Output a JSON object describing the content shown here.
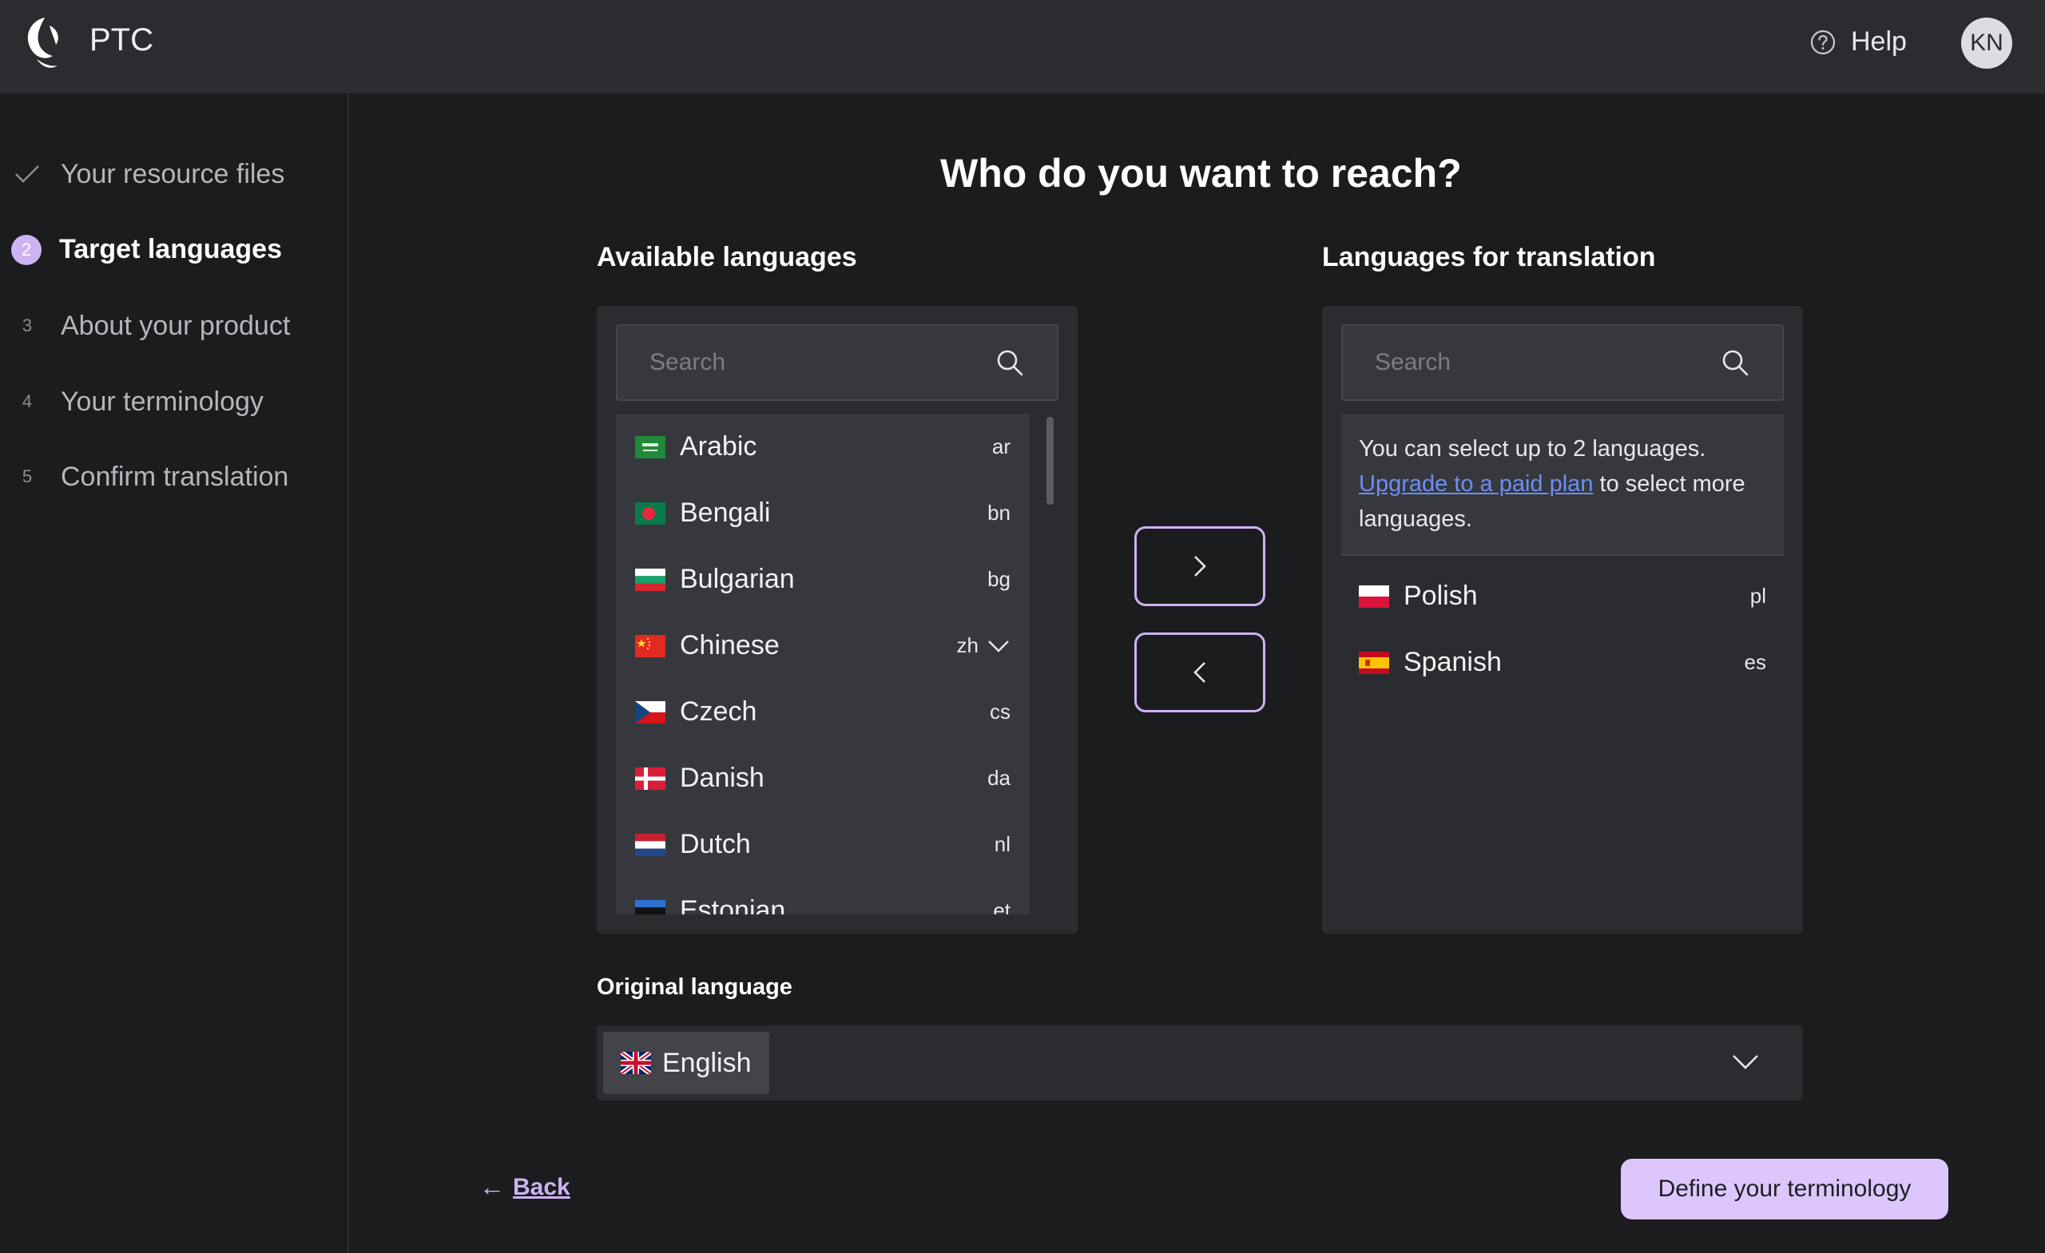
{
  "header": {
    "brand": "PTC",
    "help_label": "Help",
    "avatar_initials": "KN"
  },
  "sidebar": {
    "steps": [
      {
        "marker": "✓",
        "label": "Your resource files",
        "state": "done"
      },
      {
        "marker": "2",
        "label": "Target languages",
        "state": "active"
      },
      {
        "marker": "3",
        "label": "About your product",
        "state": "pending"
      },
      {
        "marker": "4",
        "label": "Your terminology",
        "state": "pending"
      },
      {
        "marker": "5",
        "label": "Confirm translation",
        "state": "pending"
      }
    ]
  },
  "main": {
    "title": "Who do you want to reach?",
    "available": {
      "title": "Available languages",
      "search_placeholder": "Search",
      "items": [
        {
          "name": "Arabic",
          "code": "ar",
          "flag": "sa-flag"
        },
        {
          "name": "Bengali",
          "code": "bn",
          "flag": "bd-flag"
        },
        {
          "name": "Bulgarian",
          "code": "bg",
          "flag": "bg-flag"
        },
        {
          "name": "Chinese",
          "code": "zh",
          "flag": "cn-flag",
          "expandable": true
        },
        {
          "name": "Czech",
          "code": "cs",
          "flag": "cz-flag"
        },
        {
          "name": "Danish",
          "code": "da",
          "flag": "dk-flag"
        },
        {
          "name": "Dutch",
          "code": "nl",
          "flag": "nl-flag"
        },
        {
          "name": "Estonian",
          "code": "et",
          "flag": "ee-flag"
        }
      ]
    },
    "selected": {
      "title": "Languages for translation",
      "search_placeholder": "Search",
      "notice_pre": "You can select up to 2 languages.",
      "notice_link": "Upgrade to a paid plan",
      "notice_post": "to select more languages.",
      "items": [
        {
          "name": "Polish",
          "code": "pl",
          "flag": "pl-flag"
        },
        {
          "name": "Spanish",
          "code": "es",
          "flag": "es-flag"
        }
      ]
    },
    "original": {
      "label": "Original language",
      "value": "English",
      "flag": "gb-flag"
    }
  },
  "footer": {
    "back_arrow": "←",
    "back_label": "Back",
    "next_label": "Define your terminology"
  },
  "colors": {
    "accent": "#cdb3f2",
    "primary_button": "#dcc6fb",
    "link": "#6d8ef5",
    "header_bg": "#2a2c30",
    "page_bg": "#1a1c1e"
  }
}
